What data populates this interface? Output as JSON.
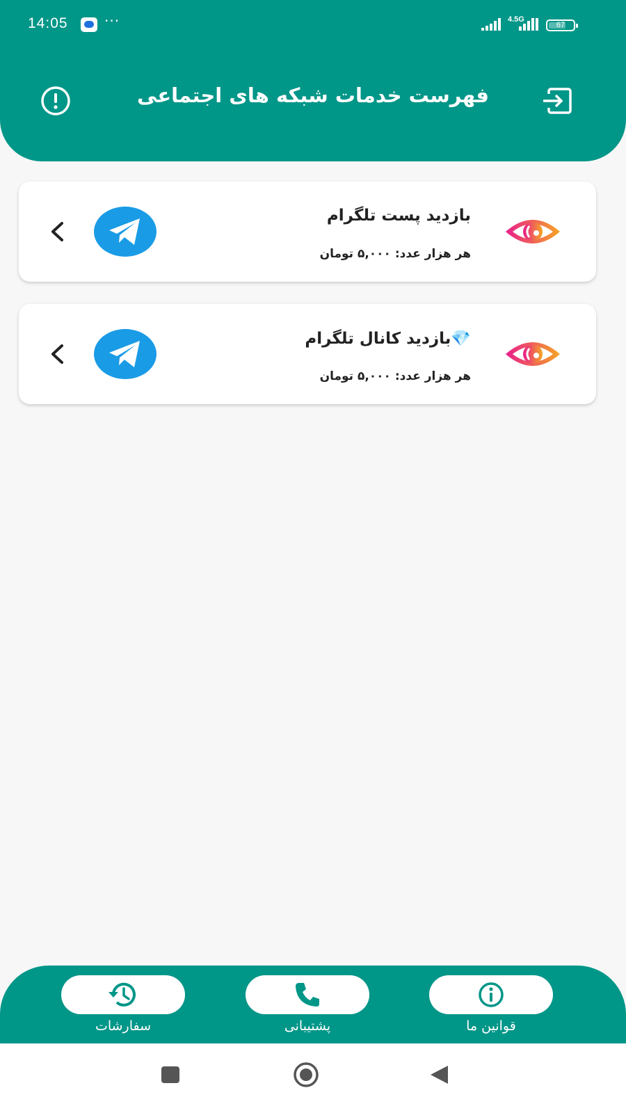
{
  "status_bar": {
    "time": "14:05",
    "dots": "···",
    "network": "4.5G",
    "battery": "67"
  },
  "header": {
    "title": "فهرست خدمات شبکه های اجتماعی",
    "left_icon": "alert-circle-icon",
    "right_icon": "logout-icon",
    "color": "#009688"
  },
  "services": [
    {
      "title": "بازدید پست تلگرام",
      "price": "هر هزار عدد: ۵,۰۰۰ تومان",
      "icon": "eye-icon",
      "platform_icon": "telegram-icon"
    },
    {
      "title": "💎بازدید کانال تلگرام",
      "price": "هر هزار عدد: ۵,۰۰۰ تومان",
      "icon": "eye-icon",
      "platform_icon": "telegram-icon"
    }
  ],
  "bottom_nav": {
    "items": [
      {
        "label": "سفارشات",
        "icon": "history-icon"
      },
      {
        "label": "پشتیبانی",
        "icon": "phone-icon"
      },
      {
        "label": "قوانین ما",
        "icon": "info-icon"
      }
    ]
  },
  "colors": {
    "primary": "#009688",
    "telegram": "#1a9be6",
    "eye_gradient_start": "#e91e8c",
    "eye_gradient_end": "#f5a623"
  }
}
